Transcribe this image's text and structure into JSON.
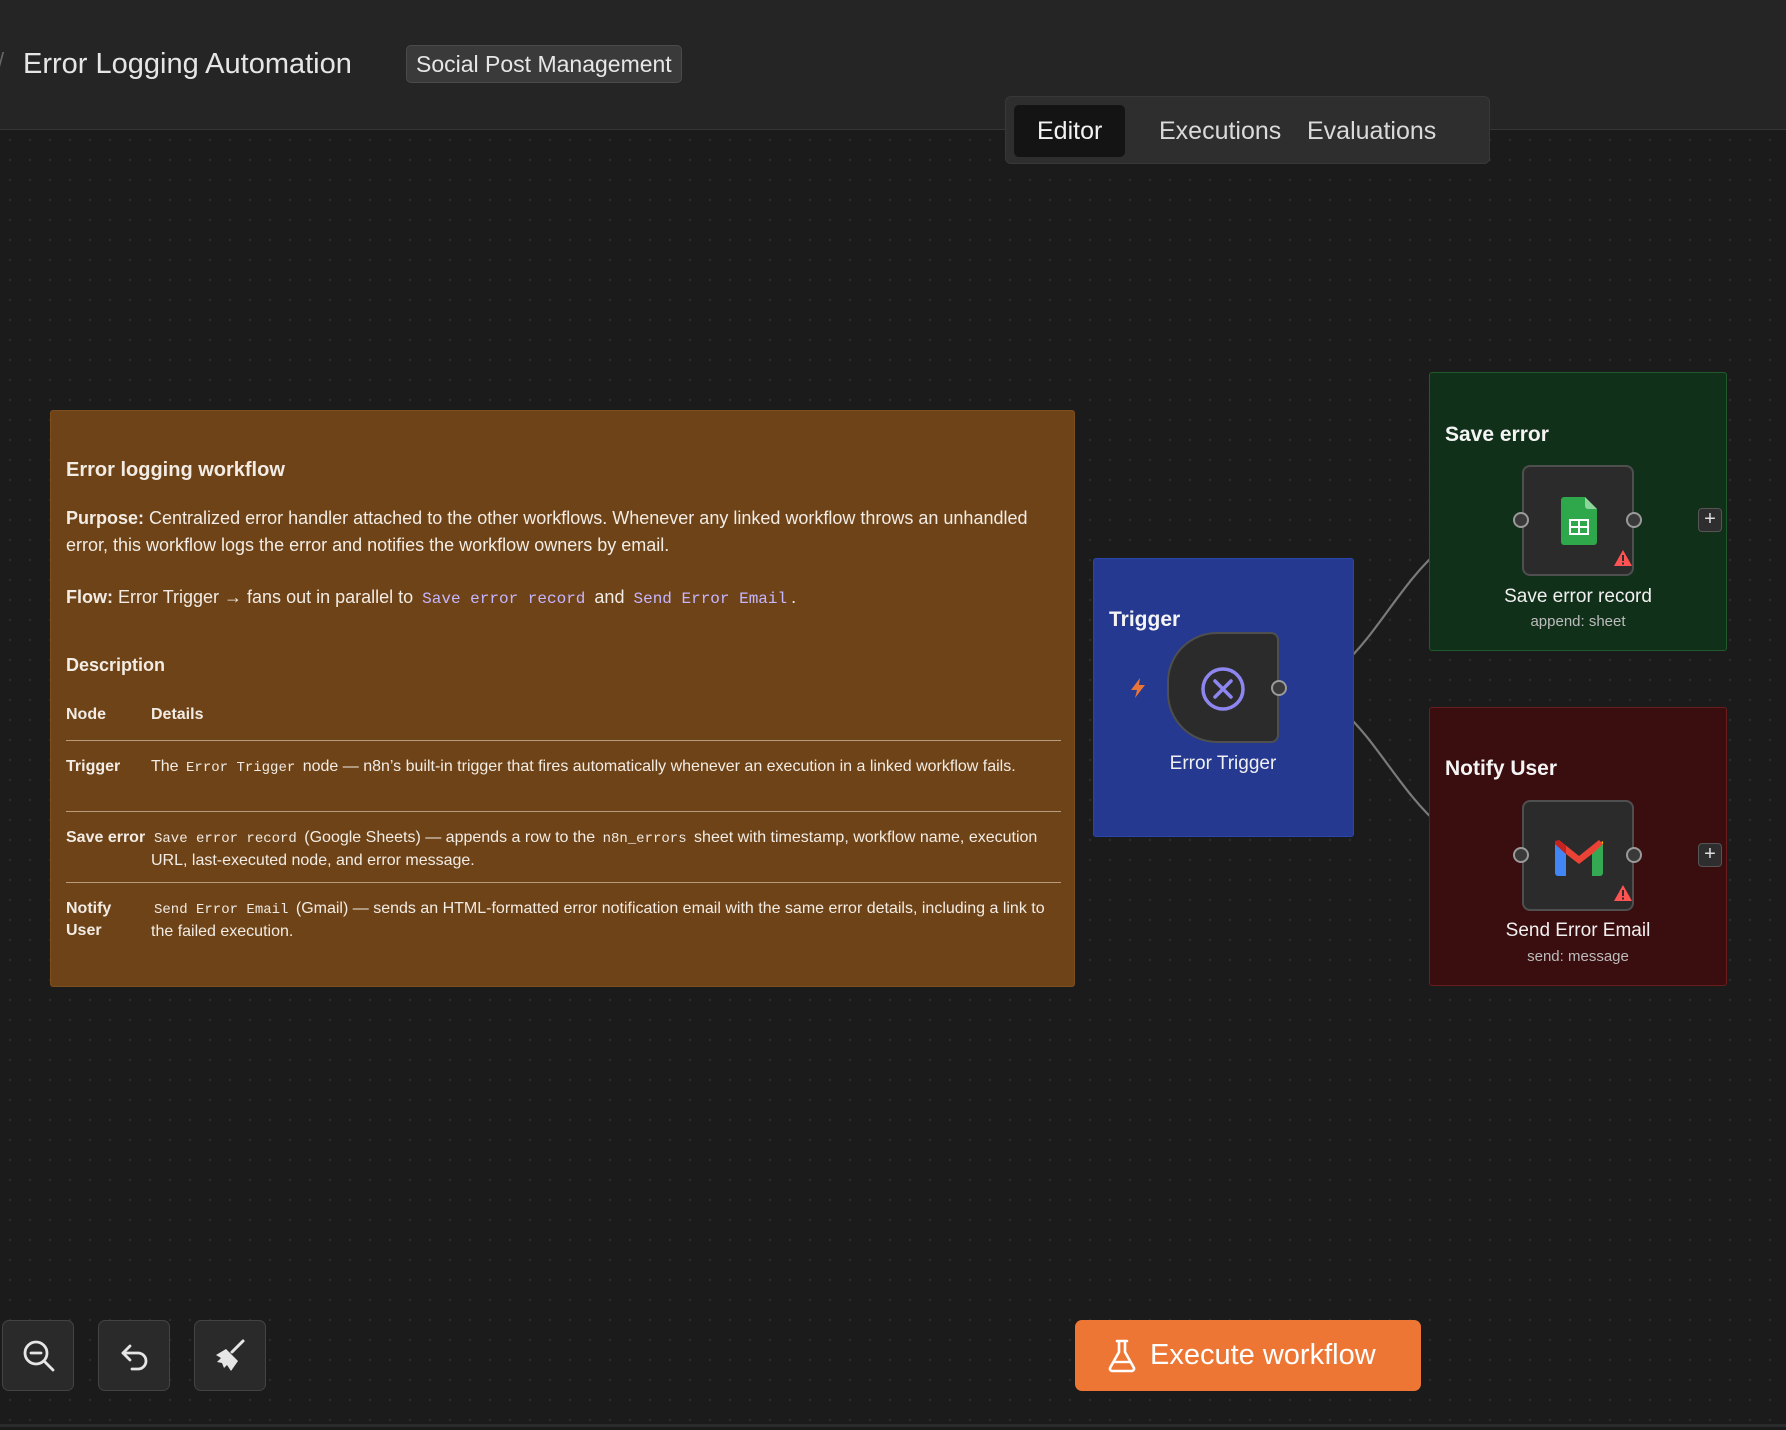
{
  "header": {
    "workflow_name": "Error Logging Automation",
    "tag": "Social Post Management",
    "tabs": [
      {
        "label": "Editor",
        "active": true
      },
      {
        "label": "Executions",
        "active": false
      },
      {
        "label": "Evaluations",
        "active": false
      }
    ]
  },
  "sticky_note": {
    "title": "Error logging workflow",
    "purpose_label": "Purpose:",
    "purpose_text": "Centralized error handler attached to the other workflows. Whenever any linked workflow throws an unhandled error, this workflow logs the error and notifies the workflow owners by email.",
    "flow_label": "Flow:",
    "flow_text": "Error Trigger → fans out in parallel to",
    "flow_code_1": "Save error record",
    "flow_and": "and",
    "flow_code_2": "Send Error Email",
    "flow_end": ".",
    "description_heading": "Description",
    "table_headers": {
      "node": "Node",
      "details": "Details"
    },
    "rows": [
      {
        "node": "Trigger",
        "pre": "The",
        "code": "Error Trigger",
        "post": "node — n8n’s built-in trigger that fires automatically whenever an execution in a linked workflow fails."
      },
      {
        "node": "Save error",
        "pre": "",
        "code": "Save error record",
        "post": "(Google Sheets) — appends a row to the",
        "code2": "n8n_errors",
        "post2": "sheet with timestamp, workflow name, execution URL, last-executed node, and error message."
      },
      {
        "node": "Notify User",
        "pre": "",
        "code": "Send Error Email",
        "post": "(Gmail) — sends an HTML-formatted error notification email with the same error details, including a link to the failed execution."
      }
    ]
  },
  "groups": {
    "trigger": {
      "title": "Trigger",
      "color": "#24398f"
    },
    "save": {
      "title": "Save error",
      "color": "#11301a"
    },
    "notify": {
      "title": "Notify User",
      "color": "#3a0d0e"
    }
  },
  "nodes": {
    "error_trigger": {
      "label": "Error Trigger",
      "icon": "x-circle-icon"
    },
    "save_error_record": {
      "label": "Save error record",
      "subtitle": "append: sheet",
      "icon": "google-sheets-icon"
    },
    "send_error_email": {
      "label": "Send Error Email",
      "subtitle": "send: message",
      "icon": "gmail-icon"
    }
  },
  "toolbar": {
    "zoom_out": "zoom-out-icon",
    "undo": "undo-icon",
    "tidy": "broom-icon",
    "execute_label": "Execute workflow"
  },
  "colors": {
    "accent": "#ee7634",
    "warning": "#ff5252"
  }
}
